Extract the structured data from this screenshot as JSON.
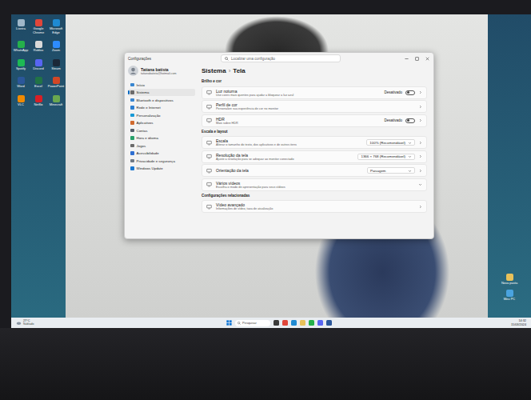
{
  "desktop": {
    "icons_left": [
      {
        "label": "Lixeira",
        "color": "#9fb7c9"
      },
      {
        "label": "Google Chrome",
        "color": "#e0463a"
      },
      {
        "label": "Microsoft Edge",
        "color": "#1f8ad2"
      },
      {
        "label": "WhatsApp",
        "color": "#25b04b"
      },
      {
        "label": "Roblox",
        "color": "#d9d9d9"
      },
      {
        "label": "Zoom",
        "color": "#2d8cff"
      },
      {
        "label": "Spotify",
        "color": "#1db954"
      },
      {
        "label": "Discord",
        "color": "#5865f2"
      },
      {
        "label": "Steam",
        "color": "#1b2838"
      },
      {
        "label": "Word",
        "color": "#2b579a"
      },
      {
        "label": "Excel",
        "color": "#217346"
      },
      {
        "label": "PowerPoint",
        "color": "#d24726"
      },
      {
        "label": "VLC",
        "color": "#f08a00"
      },
      {
        "label": "Netflix",
        "color": "#d81f26"
      },
      {
        "label": "Minecraft",
        "color": "#6aa84f"
      }
    ],
    "icons_right": [
      {
        "label": "Nova pasta",
        "color": "#e8c15a"
      },
      {
        "label": "Meu PC",
        "color": "#4aa3df"
      }
    ]
  },
  "window": {
    "title": "Configurações",
    "search": {
      "placeholder": "Localizar uma configuração"
    }
  },
  "profile": {
    "name": "Tatiana batista",
    "email": "tatianabatista@hotmail.com"
  },
  "sidebar": {
    "items": [
      {
        "label": "Início",
        "selected": false
      },
      {
        "label": "Sistema",
        "selected": true
      },
      {
        "label": "Bluetooth e dispositivos",
        "selected": false
      },
      {
        "label": "Rede e Internet",
        "selected": false
      },
      {
        "label": "Personalização",
        "selected": false
      },
      {
        "label": "Aplicativos",
        "selected": false
      },
      {
        "label": "Contas",
        "selected": false
      },
      {
        "label": "Hora e idioma",
        "selected": false
      },
      {
        "label": "Jogos",
        "selected": false
      },
      {
        "label": "Acessibilidade",
        "selected": false
      },
      {
        "label": "Privacidade e segurança",
        "selected": false
      },
      {
        "label": "Windows Update",
        "selected": false
      }
    ]
  },
  "breadcrumb": {
    "parent": "Sistema",
    "separator": "›",
    "current": "Tela"
  },
  "sections": [
    {
      "title": "Brilho e cor",
      "rows": [
        {
          "kind": "toggle",
          "title": "Luz noturna",
          "description": "Use cores mais quentes para ajudar a bloquear a luz azul",
          "value": "Desativado",
          "on": false
        },
        {
          "kind": "link",
          "title": "Perfil de cor",
          "description": "Personalize sua experiência de cor no monitor"
        },
        {
          "kind": "toggle",
          "title": "HDR",
          "description": "Mais sobre HDR",
          "value": "Desativado",
          "on": false
        }
      ]
    },
    {
      "title": "Escala e layout",
      "rows": [
        {
          "kind": "select",
          "title": "Escala",
          "description": "Alterar o tamanho do texto, dos aplicativos e de outros itens",
          "value": "100% (Recomendável)"
        },
        {
          "kind": "select",
          "title": "Resolução da tela",
          "description": "Ajuste a resolução para se adequar ao monitor conectado",
          "value": "1366 × 768 (Recomendável)"
        },
        {
          "kind": "select",
          "title": "Orientação da tela",
          "description": "",
          "value": "Paisagem"
        },
        {
          "kind": "expand",
          "title": "Vários vídeos",
          "description": "Escolha o modo de apresentação para seus vídeos"
        }
      ]
    },
    {
      "title": "Configurações relacionadas",
      "rows": [
        {
          "kind": "link",
          "title": "Vídeo avançado",
          "description": "Informações de vídeo, taxa de atualização"
        }
      ]
    }
  ],
  "taskbar": {
    "weather": {
      "temp": "27°C",
      "condition": "Nublado"
    },
    "search": {
      "placeholder": "Pesquisar"
    },
    "time": "14:32",
    "date": "15/03/2024"
  }
}
